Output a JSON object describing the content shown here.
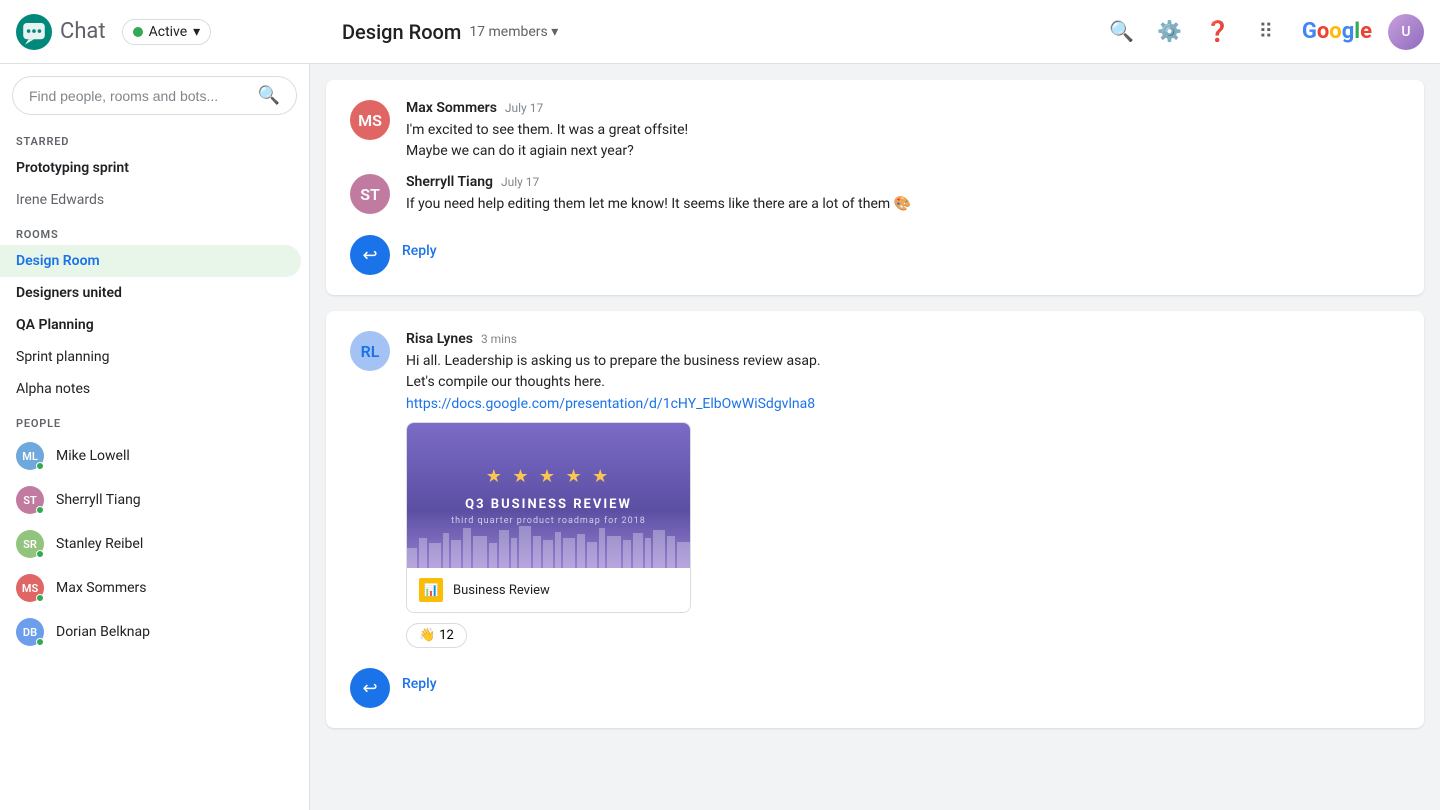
{
  "header": {
    "app_title": "Chat",
    "active_label": "Active",
    "room_title": "Design Room",
    "members_label": "17 members",
    "search_tooltip": "Search",
    "settings_tooltip": "Settings",
    "help_tooltip": "Help",
    "apps_tooltip": "Google apps",
    "google_label": "Google"
  },
  "sidebar": {
    "search_placeholder": "Find people, rooms and bots...",
    "starred_label": "STARRED",
    "starred_items": [
      {
        "name": "Prototyping sprint",
        "bold": true
      },
      {
        "name": "Irene Edwards",
        "bold": false
      }
    ],
    "rooms_label": "ROOMS",
    "rooms": [
      {
        "name": "Design Room",
        "active": true,
        "bold": true
      },
      {
        "name": "Designers united",
        "bold": true
      },
      {
        "name": "QA Planning",
        "bold": true
      },
      {
        "name": "Sprint planning",
        "bold": false
      },
      {
        "name": "Alpha notes",
        "bold": false
      }
    ],
    "people_label": "PEOPLE",
    "people": [
      {
        "name": "Mike Lowell",
        "initials": "ML",
        "color": "#6fa8dc"
      },
      {
        "name": "Sherryll Tiang",
        "initials": "ST",
        "color": "#c27ba0"
      },
      {
        "name": "Stanley Reibel",
        "initials": "SR",
        "color": "#93c47d"
      },
      {
        "name": "Max Sommers",
        "initials": "MS",
        "color": "#e06666"
      },
      {
        "name": "Dorian Belknap",
        "initials": "DB",
        "color": "#6d9eeb"
      }
    ]
  },
  "messages": [
    {
      "id": "msg1",
      "card": {
        "groups": [
          {
            "sender": "Max Sommers",
            "time": "July 17",
            "avatar_color": "#e06666",
            "avatar_initials": "MS",
            "lines": [
              "I'm excited to see them. It was a great offsite!",
              "Maybe we can do it agiain next year?"
            ]
          },
          {
            "sender": "Sherryll Tiang",
            "time": "July 17",
            "avatar_color": "#c27ba0",
            "avatar_initials": "ST",
            "lines": [
              "If you need help editing them let me know! It seems like there are a lot of them 🎨"
            ]
          }
        ],
        "reply_label": "Reply"
      }
    },
    {
      "id": "msg2",
      "card": {
        "groups": [
          {
            "sender": "Risa Lynes",
            "time": "3 mins",
            "avatar_color": "#a4c2f4",
            "avatar_initials": "RL",
            "lines": [
              "Hi all. Leadership is asking us to prepare the business review asap.",
              "Let's compile our thoughts here."
            ],
            "link": "https://docs.google.com/presentation/d/1cHY_ElbOwWiSdgvlna8",
            "link_display": "https://docs.google.com/presentation/d/1cHY_ElbOwWiSdgvlna8",
            "preview": {
              "stars": "★★★★★",
              "title": "Q3 BUSINESS REVIEW",
              "subtitle": "third quarter product roadmap for 2018",
              "doc_name": "Business Review"
            },
            "reaction": {
              "emoji": "👋",
              "count": "12"
            }
          }
        ],
        "reply_label": "Reply"
      }
    }
  ]
}
